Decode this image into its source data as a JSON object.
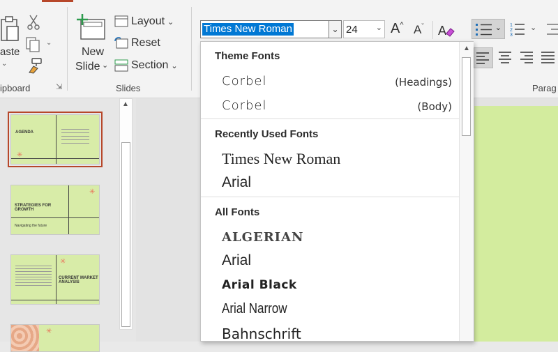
{
  "ribbon": {
    "clipboard": {
      "paste_label": "aste",
      "group_label": "ipboard"
    },
    "slides": {
      "new_slide_line1": "New",
      "new_slide_line2": "Slide",
      "layout_label": "Layout",
      "reset_label": "Reset",
      "section_label": "Section",
      "group_label": "Slides"
    },
    "font": {
      "name_value": "Times New Roman",
      "size_value": "24"
    },
    "paragraph": {
      "group_label": "Parag"
    }
  },
  "font_dropdown": {
    "theme_header": "Theme Fonts",
    "theme_fonts": [
      {
        "name": "Corbel",
        "hint": "(Headings)"
      },
      {
        "name": "Corbel",
        "hint": "(Body)"
      }
    ],
    "recent_header": "Recently Used Fonts",
    "recent_fonts": [
      "Times New Roman",
      "Arial"
    ],
    "all_header": "All Fonts",
    "all_fonts": [
      "ALGERIAN",
      "Arial",
      "Arial Black",
      "Arial Narrow",
      "Bahnschrift"
    ]
  },
  "thumbnails": [
    {
      "title": "AGENDA",
      "selected": true
    },
    {
      "title": "STRATEGIES FOR GROWTH",
      "subtitle": "Navigating the future"
    },
    {
      "title": "CURRENT MARKET ANALYSIS"
    },
    {
      "title": ""
    }
  ],
  "colors": {
    "accent": "#b7472a",
    "selection": "#0078d4",
    "slide_bg": "#d3ec9e"
  }
}
